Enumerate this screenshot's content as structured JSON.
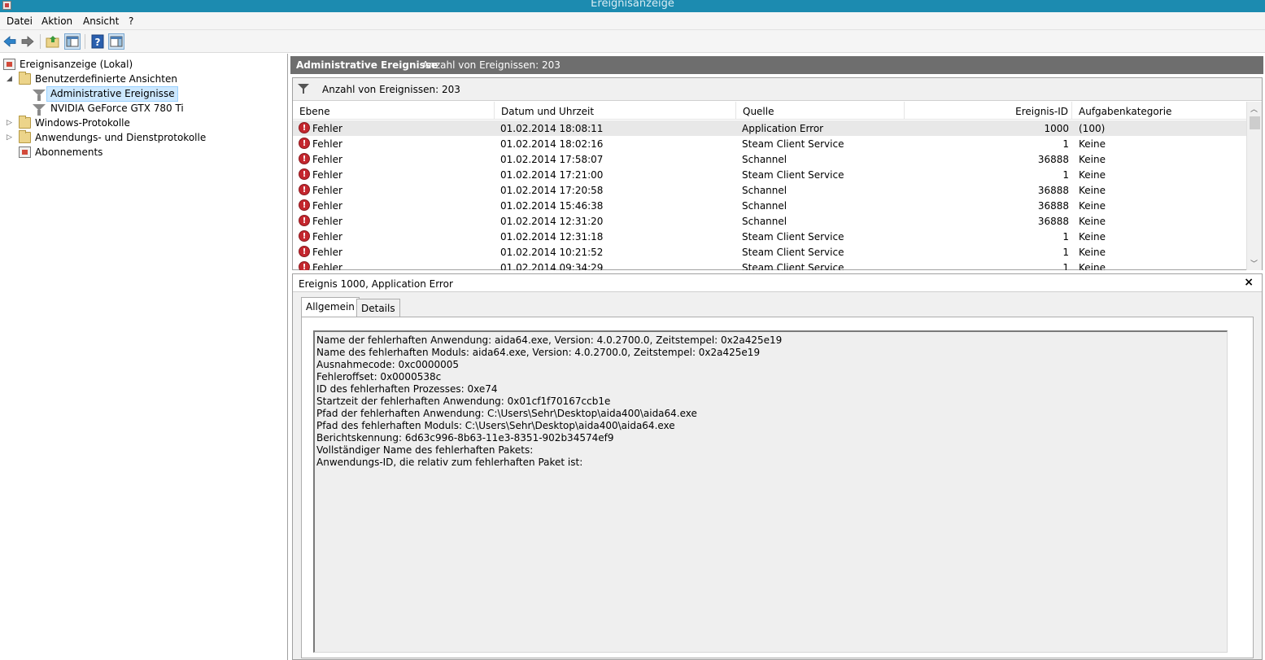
{
  "window": {
    "title": "Ereignisanzeige"
  },
  "menubar": [
    "Datei",
    "Aktion",
    "Ansicht",
    "?"
  ],
  "toolbar": [
    "back-icon",
    "forward-icon",
    "up-folder-icon",
    "show-hide-tree-icon",
    "help-icon",
    "show-hide-action-pane-icon"
  ],
  "tree": {
    "root": "Ereignisanzeige (Lokal)",
    "custom_views": "Benutzerdefinierte Ansichten",
    "admin_events": "Administrative Ereignisse",
    "nvidia": "NVIDIA GeForce GTX 780 Ti",
    "windows_logs": "Windows-Protokolle",
    "app_service_logs": "Anwendungs- und Dienstprotokolle",
    "subscriptions": "Abonnements"
  },
  "view_header": {
    "title": "Administrative Ereignisse",
    "count": "Anzahl von Ereignissen: 203"
  },
  "filter": {
    "label": "Anzahl von Ereignissen: 203"
  },
  "columns": [
    "Ebene",
    "Datum und Uhrzeit",
    "Quelle",
    "Ereignis-ID",
    "Aufgabenkategorie"
  ],
  "events": [
    {
      "level": "Fehler",
      "datetime": "01.02.2014 18:08:11",
      "source": "Application Error",
      "id": "1000",
      "category": "(100)"
    },
    {
      "level": "Fehler",
      "datetime": "01.02.2014 18:02:16",
      "source": "Steam Client Service",
      "id": "1",
      "category": "Keine"
    },
    {
      "level": "Fehler",
      "datetime": "01.02.2014 17:58:07",
      "source": "Schannel",
      "id": "36888",
      "category": "Keine"
    },
    {
      "level": "Fehler",
      "datetime": "01.02.2014 17:21:00",
      "source": "Steam Client Service",
      "id": "1",
      "category": "Keine"
    },
    {
      "level": "Fehler",
      "datetime": "01.02.2014 17:20:58",
      "source": "Schannel",
      "id": "36888",
      "category": "Keine"
    },
    {
      "level": "Fehler",
      "datetime": "01.02.2014 15:46:38",
      "source": "Schannel",
      "id": "36888",
      "category": "Keine"
    },
    {
      "level": "Fehler",
      "datetime": "01.02.2014 12:31:20",
      "source": "Schannel",
      "id": "36888",
      "category": "Keine"
    },
    {
      "level": "Fehler",
      "datetime": "01.02.2014 12:31:18",
      "source": "Steam Client Service",
      "id": "1",
      "category": "Keine"
    },
    {
      "level": "Fehler",
      "datetime": "01.02.2014 10:21:52",
      "source": "Steam Client Service",
      "id": "1",
      "category": "Keine"
    },
    {
      "level": "Fehler",
      "datetime": "01.02.2014 09:34:29",
      "source": "Steam Client Service",
      "id": "1",
      "category": "Keine"
    }
  ],
  "detail": {
    "title": "Ereignis 1000, Application Error",
    "close": "×",
    "tabs": [
      "Allgemein",
      "Details"
    ],
    "lines": [
      "Name der fehlerhaften Anwendung: aida64.exe, Version: 4.0.2700.0, Zeitstempel: 0x2a425e19",
      "Name des fehlerhaften Moduls: aida64.exe, Version: 4.0.2700.0, Zeitstempel: 0x2a425e19",
      "Ausnahmecode: 0xc0000005",
      "Fehleroffset: 0x0000538c",
      "ID des fehlerhaften Prozesses: 0xe74",
      "Startzeit der fehlerhaften Anwendung: 0x01cf1f70167ccb1e",
      "Pfad der fehlerhaften Anwendung: C:\\Users\\Sehr\\Desktop\\aida400\\aida64.exe",
      "Pfad des fehlerhaften Moduls: C:\\Users\\Sehr\\Desktop\\aida400\\aida64.exe",
      "Berichtskennung: 6d63c996-8b63-11e3-8351-902b34574ef9",
      "Vollständiger Name des fehlerhaften Pakets:",
      "Anwendungs-ID, die relativ zum fehlerhaften Paket ist:"
    ]
  }
}
